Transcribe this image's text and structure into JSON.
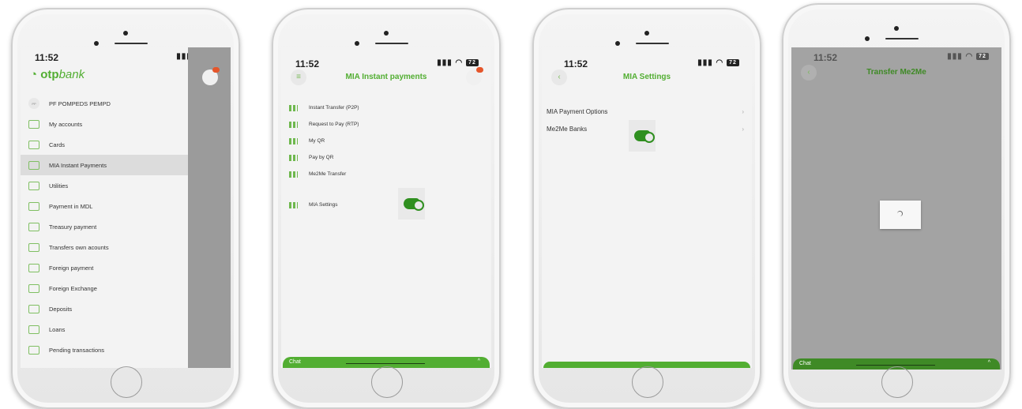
{
  "status": {
    "time": "11:52",
    "battery": "72"
  },
  "screen1": {
    "logo_brand": "otp",
    "logo_suffix": "bank",
    "user": "PF POMPEDS PEMPD",
    "menu": [
      "My accounts",
      "Cards",
      "MIA Instant Payments",
      "Utilities",
      "Payment in MDL",
      "Treasury payment",
      "Transfers own acounts",
      "Foreign payment",
      "Foreign Exchange",
      "Deposits",
      "Loans",
      "Pending transactions"
    ]
  },
  "screen2": {
    "title": "MIA Instant payments",
    "items": [
      "Instant Transfer (P2P)",
      "Request to Pay (RTP)",
      "My QR",
      "Pay by QR",
      "Me2Me Transfer"
    ],
    "settings": "MIA Settings",
    "chat": "Chat"
  },
  "screen3": {
    "title": "MIA Settings",
    "items": [
      "MIA Payment Options",
      "Me2Me Banks"
    ]
  },
  "screen4": {
    "title": "Transfer Me2Me",
    "chat": "Chat"
  },
  "colors": {
    "brand_green": "#52ae32",
    "overlay_gray": "#9b9b9b",
    "badge_orange": "#e5562b"
  }
}
